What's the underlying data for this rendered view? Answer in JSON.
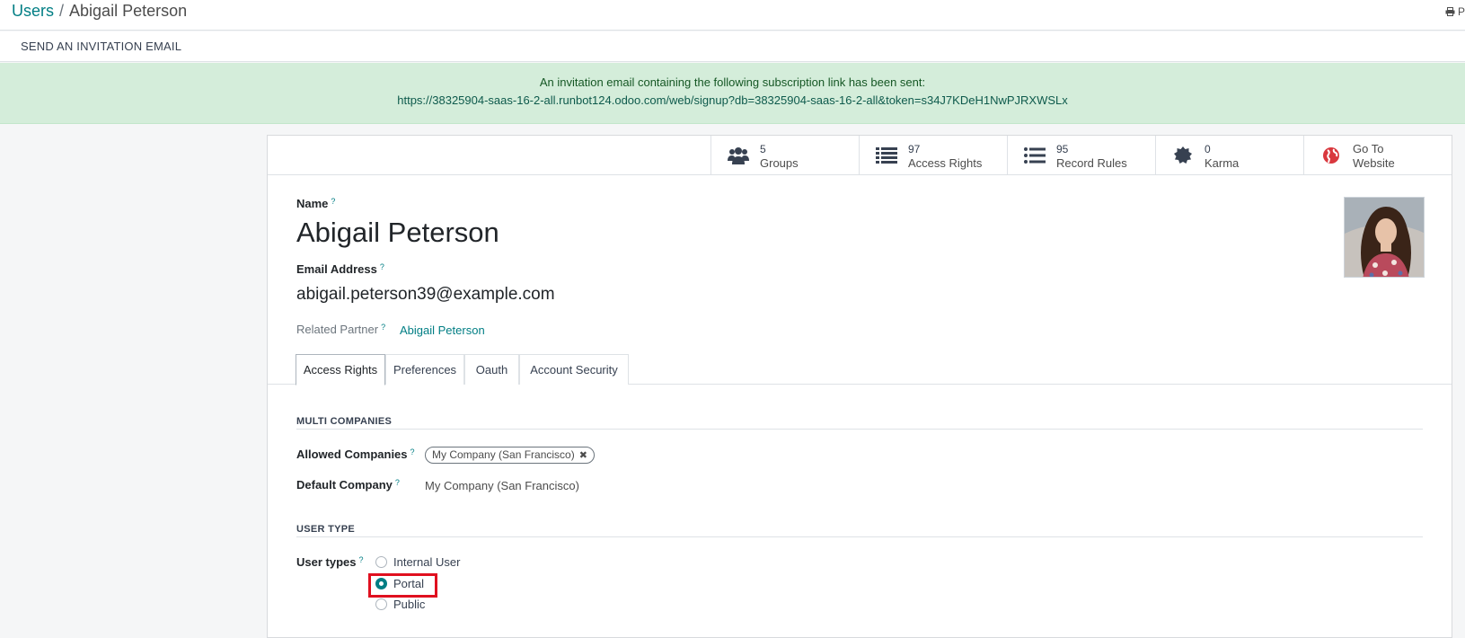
{
  "breadcrumb": {
    "parent": "Users",
    "separator": "/",
    "current": "Abigail Peterson"
  },
  "print": {
    "label": "P"
  },
  "actions": {
    "invite": "SEND AN INVITATION EMAIL"
  },
  "alert": {
    "line1": "An invitation email containing the following subscription link has been sent:",
    "link": "https://38325904-saas-16-2-all.runbot124.odoo.com/web/signup?db=38325904-saas-16-2-all&token=s34J7KDeH1NwPJRXWSLx"
  },
  "stats": [
    {
      "icon": "users-icon",
      "count": "5",
      "label": "Groups"
    },
    {
      "icon": "list-icon",
      "count": "97",
      "label": "Access Rights"
    },
    {
      "icon": "list-icon",
      "count": "95",
      "label": "Record Rules"
    },
    {
      "icon": "certificate-icon",
      "count": "0",
      "label": "Karma"
    },
    {
      "icon": "globe-icon",
      "count": "Go To",
      "label": "Website"
    }
  ],
  "form": {
    "name_label": "Name",
    "name_value": "Abigail Peterson",
    "email_label": "Email Address",
    "email_value": "abigail.peterson39@example.com",
    "partner_label": "Related Partner",
    "partner_value": "Abigail Peterson",
    "help_mark": "?"
  },
  "tabs": [
    "Access Rights",
    "Preferences",
    "Oauth",
    "Account Security"
  ],
  "multi": {
    "title": "MULTI COMPANIES",
    "allowed_label": "Allowed Companies",
    "allowed_tag": "My Company (San Francisco)",
    "default_label": "Default Company",
    "default_value": "My Company (San Francisco)"
  },
  "usertype": {
    "title": "USER TYPE",
    "label": "User types",
    "options": [
      "Internal User",
      "Portal",
      "Public"
    ],
    "selected": "Portal"
  },
  "colors": {
    "accent": "#017e84",
    "alert_bg": "#d4edda",
    "highlight": "#e0101f"
  }
}
